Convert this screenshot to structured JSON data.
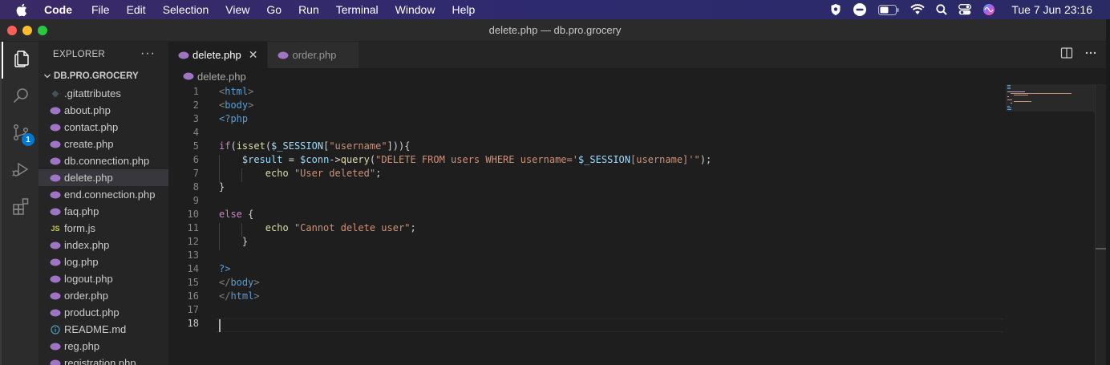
{
  "menubar": {
    "app": "Code",
    "menus": [
      "File",
      "Edit",
      "Selection",
      "View",
      "Go",
      "Run",
      "Terminal",
      "Window",
      "Help"
    ],
    "clock": "Tue 7 Jun  23:16",
    "status_icons": [
      "shield-icon",
      "message-icon",
      "battery-icon",
      "wifi-icon",
      "search-icon",
      "control-center-icon",
      "siri-icon"
    ]
  },
  "window": {
    "title": "delete.php — db.pro.grocery"
  },
  "activity": {
    "source_control_badge": "1"
  },
  "sidebar": {
    "title": "EXPLORER",
    "more": "···",
    "folder": "DB.PRO.GROCERY",
    "files": [
      {
        "name": ".gitattributes",
        "type": "git"
      },
      {
        "name": "about.php",
        "type": "php"
      },
      {
        "name": "contact.php",
        "type": "php"
      },
      {
        "name": "create.php",
        "type": "php"
      },
      {
        "name": "db.connection.php",
        "type": "php"
      },
      {
        "name": "delete.php",
        "type": "php",
        "selected": true
      },
      {
        "name": "end.connection.php",
        "type": "php"
      },
      {
        "name": "faq.php",
        "type": "php"
      },
      {
        "name": "form.js",
        "type": "js"
      },
      {
        "name": "index.php",
        "type": "php"
      },
      {
        "name": "log.php",
        "type": "php"
      },
      {
        "name": "logout.php",
        "type": "php"
      },
      {
        "name": "order.php",
        "type": "php"
      },
      {
        "name": "product.php",
        "type": "php"
      },
      {
        "name": "README.md",
        "type": "info"
      },
      {
        "name": "reg.php",
        "type": "php"
      },
      {
        "name": "registration.php",
        "type": "php"
      }
    ]
  },
  "tabs": [
    {
      "label": "delete.php",
      "active": true
    },
    {
      "label": "order.php",
      "active": false
    }
  ],
  "breadcrumb": "delete.php",
  "editor": {
    "current_line": 18,
    "lines": [
      {
        "n": "1",
        "tokens": [
          [
            "punct",
            "<"
          ],
          [
            "tag",
            "html"
          ],
          [
            "punct",
            ">"
          ]
        ]
      },
      {
        "n": "2",
        "tokens": [
          [
            "punct",
            "<"
          ],
          [
            "tag",
            "body"
          ],
          [
            "punct",
            ">"
          ]
        ]
      },
      {
        "n": "3",
        "tokens": [
          [
            "php",
            "<?php"
          ]
        ]
      },
      {
        "n": "4",
        "tokens": []
      },
      {
        "n": "5",
        "tokens": [
          [
            "kw",
            "if"
          ],
          [
            "plain",
            "("
          ],
          [
            "fn",
            "isset"
          ],
          [
            "plain",
            "("
          ],
          [
            "var",
            "$_SESSION"
          ],
          [
            "plain",
            "["
          ],
          [
            "str",
            "\"username\""
          ],
          [
            "plain",
            "])){"
          ]
        ]
      },
      {
        "n": "6",
        "tokens": [
          [
            "plain",
            "    "
          ],
          [
            "var",
            "$result"
          ],
          [
            "plain",
            " = "
          ],
          [
            "var",
            "$conn"
          ],
          [
            "plain",
            "->"
          ],
          [
            "fn",
            "query"
          ],
          [
            "plain",
            "("
          ],
          [
            "str",
            "\"DELETE FROM users WHERE username='"
          ],
          [
            "var",
            "$_SESSION"
          ],
          [
            "str",
            "[username]"
          ],
          [
            "str",
            "'\""
          ],
          [
            "plain",
            ");"
          ]
        ]
      },
      {
        "n": "7",
        "tokens": [
          [
            "plain",
            "        "
          ],
          [
            "fn",
            "echo"
          ],
          [
            "plain",
            " "
          ],
          [
            "str",
            "\"User deleted\""
          ],
          [
            "plain",
            ";"
          ]
        ]
      },
      {
        "n": "8",
        "tokens": [
          [
            "plain",
            "}"
          ]
        ]
      },
      {
        "n": "9",
        "tokens": []
      },
      {
        "n": "10",
        "tokens": [
          [
            "kw",
            "else"
          ],
          [
            "plain",
            " {"
          ]
        ]
      },
      {
        "n": "11",
        "tokens": [
          [
            "plain",
            "        "
          ],
          [
            "fn",
            "echo"
          ],
          [
            "plain",
            " "
          ],
          [
            "str",
            "\"Cannot delete user\""
          ],
          [
            "plain",
            ";"
          ]
        ]
      },
      {
        "n": "12",
        "tokens": [
          [
            "plain",
            "    }"
          ]
        ]
      },
      {
        "n": "13",
        "tokens": []
      },
      {
        "n": "14",
        "tokens": [
          [
            "php",
            "?>"
          ]
        ]
      },
      {
        "n": "15",
        "tokens": [
          [
            "punct",
            "</"
          ],
          [
            "tag",
            "body"
          ],
          [
            "punct",
            ">"
          ]
        ]
      },
      {
        "n": "16",
        "tokens": [
          [
            "punct",
            "</"
          ],
          [
            "tag",
            "html"
          ],
          [
            "punct",
            ">"
          ]
        ]
      },
      {
        "n": "17",
        "tokens": []
      },
      {
        "n": "18",
        "tokens": []
      }
    ]
  },
  "colors": {
    "php_icon": "#a074c4",
    "js_icon": "#cbcb41",
    "info_icon": "#519aba",
    "git_icon": "#41535b",
    "accent": "#0078d4"
  }
}
